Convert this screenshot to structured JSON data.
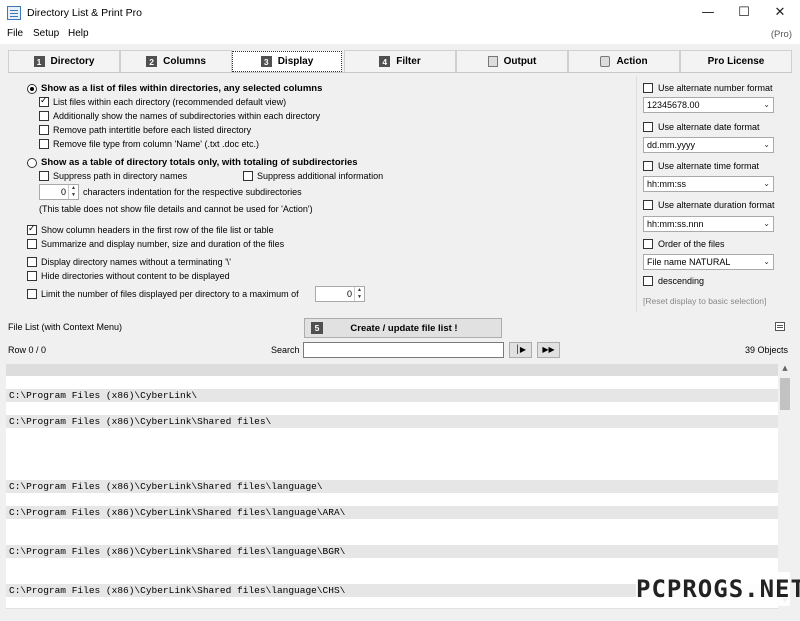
{
  "window": {
    "title": "Directory List & Print Pro"
  },
  "menu": {
    "items": [
      "File",
      "Setup",
      "Help"
    ],
    "edition": "(Pro)"
  },
  "tabs": [
    {
      "num": "1",
      "label": "Directory"
    },
    {
      "num": "2",
      "label": "Columns"
    },
    {
      "num": "3",
      "label": "Display"
    },
    {
      "num": "4",
      "label": "Filter"
    },
    {
      "label": "Output"
    },
    {
      "label": "Action"
    },
    {
      "label": "Pro License"
    }
  ],
  "display": {
    "mode_list": "Show as a list of files within directories, any selected columns",
    "list_files": "List files within each directory (recommended default view)",
    "show_subdirs": "Additionally show the names of subdirectories within each directory",
    "remove_intertitle": "Remove path intertitle before each listed directory",
    "remove_filetype": "Remove file type from column 'Name' (.txt .doc etc.)",
    "mode_table": "Show as a table of directory totals only, with totaling of subdirectories",
    "suppress_path": "Suppress path in directory names",
    "suppress_info": "Suppress additional information",
    "indent_value": "0",
    "indent_label": "characters indentation for the respective subdirectories",
    "table_note": "(This table does not show file details and cannot be used for 'Action')",
    "column_headers": "Show column headers in the first row of the file list or table",
    "summarize": "Summarize and display number, size and duration of the files",
    "no_backslash": "Display directory names without a terminating '\\'",
    "hide_empty": "Hide directories without content to be displayed",
    "limit_files": "Limit the number of files displayed per directory to a maximum of",
    "limit_value": "0"
  },
  "formats": {
    "alt_number": "Use alternate number format",
    "number_value": "12345678.00",
    "alt_date": "Use alternate date format",
    "date_value": "dd.mm.yyyy",
    "alt_time": "Use alternate time format",
    "time_value": "hh:mm:ss",
    "alt_duration": "Use alternate duration format",
    "duration_value": "hh:mm:ss.nnn",
    "order": "Order of the files",
    "order_value": "File name NATURAL",
    "descending": "descending",
    "reset": "[Reset display to basic selection]"
  },
  "filelist": {
    "label": "File List (with Context Menu)",
    "create_num": "5",
    "create_label": "Create / update file list !",
    "row": "Row 0 / 0",
    "search_label": "Search",
    "search_value": "",
    "objects": "39 Objects",
    "lines": [
      "C:\\Program Files (x86)\\CyberLink\\",
      "C:\\Program Files (x86)\\CyberLink\\Shared files\\",
      "C:\\Program Files (x86)\\CyberLink\\Shared files\\language\\",
      "C:\\Program Files (x86)\\CyberLink\\Shared files\\language\\ARA\\",
      "C:\\Program Files (x86)\\CyberLink\\Shared files\\language\\BGR\\",
      "C:\\Program Files (x86)\\CyberLink\\Shared files\\language\\CHS\\"
    ]
  },
  "watermark": "PCPROGS.NET"
}
